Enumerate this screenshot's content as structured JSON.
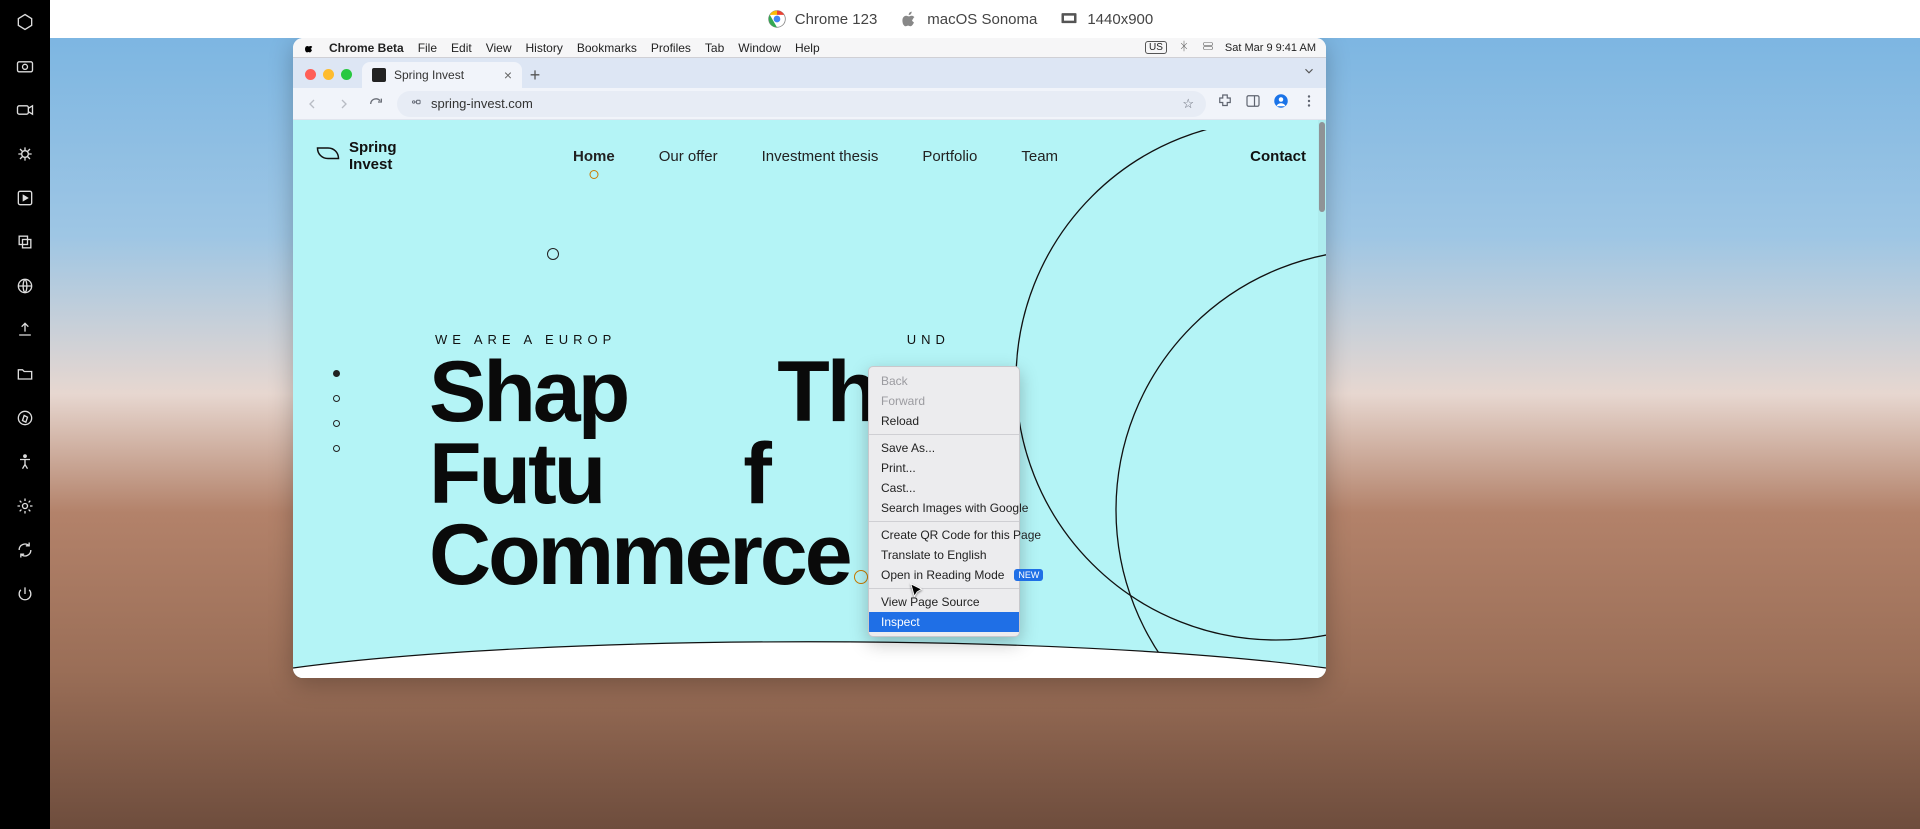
{
  "launcher": {
    "chrome": "Chrome 123",
    "macos": "macOS Sonoma",
    "resolution": "1440x900"
  },
  "mac_menu": {
    "app": "Chrome Beta",
    "items": [
      "File",
      "Edit",
      "View",
      "History",
      "Bookmarks",
      "Profiles",
      "Tab",
      "Window",
      "Help"
    ],
    "kbd": "US",
    "clock": "Sat Mar 9  9:41 AM"
  },
  "tab": {
    "title": "Spring Invest"
  },
  "url": "spring-invest.com",
  "site": {
    "brand_line1": "Spring",
    "brand_line2": "Invest",
    "nav": [
      "Home",
      "Our offer",
      "Investment thesis",
      "Portfolio",
      "Team"
    ],
    "contact": "Contact",
    "eyebrow_visible": "WE ARE A EUROP",
    "eyebrow_suffix": "UND",
    "headline_l1": "Shap",
    "headline_l1b": "The",
    "headline_l2a": "Futu",
    "headline_l2b": "f",
    "headline_l3": "Commerce"
  },
  "ctx": {
    "back": "Back",
    "forward": "Forward",
    "reload": "Reload",
    "save": "Save As...",
    "print": "Print...",
    "cast": "Cast...",
    "search_img": "Search Images with Google",
    "qr": "Create QR Code for this Page",
    "translate": "Translate to English",
    "reading": "Open in Reading Mode",
    "reading_badge": "NEW",
    "source": "View Page Source",
    "inspect": "Inspect"
  }
}
